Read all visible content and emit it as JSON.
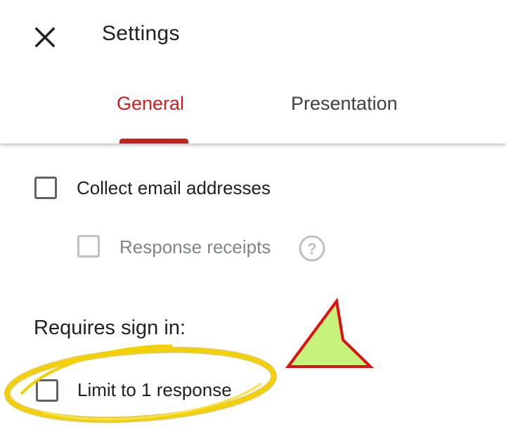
{
  "header": {
    "title": "Settings",
    "close_icon": "close-icon"
  },
  "tabs": [
    {
      "label": "General",
      "active": true
    },
    {
      "label": "Presentation",
      "active": false
    }
  ],
  "settings": {
    "collect_email": {
      "label": "Collect email addresses",
      "checked": false
    },
    "response_receipts": {
      "label": "Response receipts",
      "checked": false,
      "disabled": true,
      "help_icon": "help-circle-icon"
    }
  },
  "requires_sign_in": {
    "title": "Requires sign in:",
    "limit_response": {
      "label": "Limit to 1 response",
      "checked": false
    }
  },
  "colors": {
    "accent": "#c5221f",
    "annotation_circle": "#f4d000",
    "annotation_arrow_fill": "#c7f27b",
    "annotation_arrow_stroke": "#e01010"
  }
}
